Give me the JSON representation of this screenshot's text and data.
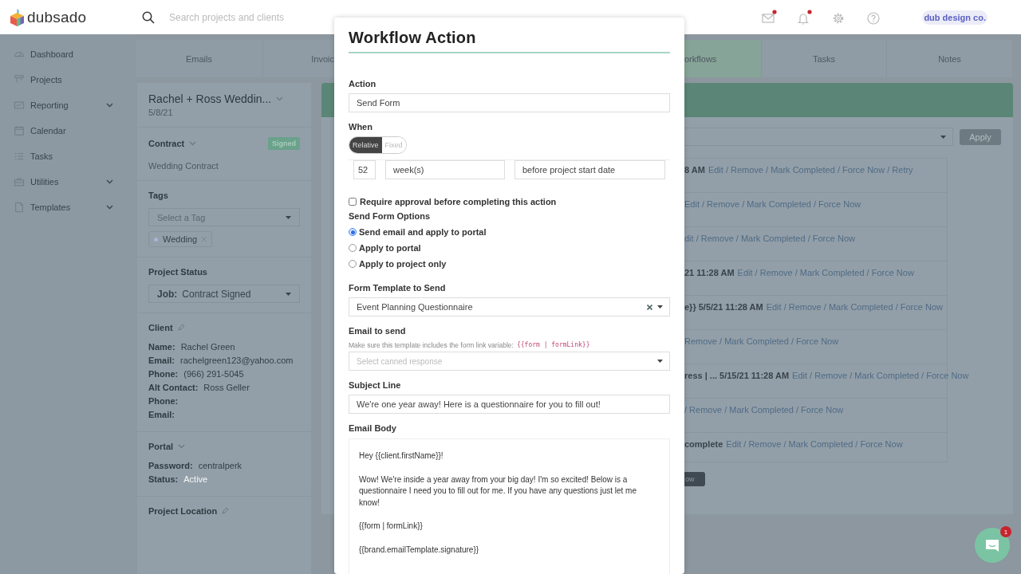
{
  "topbar": {
    "logo": "dubsado",
    "search": {
      "placeholder": "Search projects and clients"
    },
    "icons": [
      {
        "kind": "mail",
        "badge": true
      },
      {
        "kind": "bell",
        "badge": true
      },
      {
        "kind": "gear",
        "badge": false
      },
      {
        "kind": "help",
        "badge": false
      }
    ],
    "account": "dub design co."
  },
  "sidebar": {
    "items": [
      {
        "label": "Dashboard",
        "kind": "dashboard",
        "has_submenu": false
      },
      {
        "label": "Projects",
        "kind": "projects",
        "has_submenu": false
      },
      {
        "label": "Reporting",
        "kind": "reporting",
        "has_submenu": true
      },
      {
        "label": "Calendar",
        "kind": "calendar",
        "has_submenu": false
      },
      {
        "label": "Tasks",
        "kind": "tasks",
        "has_submenu": false
      },
      {
        "label": "Utilities",
        "kind": "utilities",
        "has_submenu": true
      },
      {
        "label": "Templates",
        "kind": "templates",
        "has_submenu": true
      }
    ]
  },
  "tabs": {
    "left": [
      {
        "label": "Emails",
        "selected": false
      },
      {
        "label": "Invoic",
        "selected": false
      }
    ],
    "right": [
      {
        "label": "orkflows",
        "selected": true
      },
      {
        "label": "Tasks",
        "selected": false
      },
      {
        "label": "Notes",
        "selected": false
      }
    ]
  },
  "project": {
    "title": "Rachel + Ross Weddin...",
    "date": "5/8/21",
    "contract": {
      "heading": "Contract",
      "status": "Signed",
      "name": "Wedding Contract"
    },
    "tags": {
      "heading": "Tags",
      "placeholder": "Select a Tag",
      "items": [
        {
          "label": "Wedding"
        }
      ]
    },
    "status": {
      "heading": "Project Status",
      "label": "Job:",
      "value": "Contract Signed"
    },
    "client": {
      "heading": "Client",
      "fields": [
        {
          "label": "Name:",
          "value": "Rachel Green"
        },
        {
          "label": "Email:",
          "value": "rachelgreen123@yahoo.com"
        },
        {
          "label": "Phone:",
          "value": "(966) 291-5045"
        },
        {
          "label": "Alt Contact:",
          "value": "Ross Geller"
        },
        {
          "label": "Phone:"
        },
        {
          "label": "Email:"
        }
      ]
    },
    "portal": {
      "heading": "Portal",
      "fields": [
        {
          "label": "Password:",
          "value": "centralperk",
          "muted": false
        },
        {
          "label": "Status:",
          "value": "Active",
          "muted": true
        }
      ]
    },
    "location": {
      "heading": "Project Location"
    }
  },
  "workflow": {
    "apply_button": "Apply",
    "rows": [
      {
        "prefix": "8 AM",
        "actions": "Edit / Remove / Mark Completed / Force Now / Retry"
      },
      {
        "actions": "Edit / Remove / Mark Completed / Force Now"
      },
      {
        "actions": "dit / Remove / Mark Completed / Force Now"
      },
      {
        "prefix": "21 11:28 AM",
        "actions": "Edit / Remove / Mark Completed / Force Now"
      },
      {
        "prefix": "e}} 5/5/21 11:28 AM",
        "actions": "Edit / Remove / Mark Completed / Force Now"
      },
      {
        "actions": "Remove / Mark Completed / Force Now"
      },
      {
        "prefix": "ress | ... 5/15/21 11:28 AM",
        "actions": "Edit / Remove / Mark Completed / Force Now"
      },
      {
        "actions": "/ Remove / Mark Completed / Force Now"
      },
      {
        "prefix": "complete",
        "actions": "Edit / Remove / Mark Completed / Force Now"
      }
    ],
    "bottom_button": "ow"
  },
  "modal": {
    "title": "Workflow Action",
    "action": {
      "label": "Action",
      "value": "Send Form"
    },
    "when": {
      "label": "When",
      "modes": [
        {
          "label": "Relative",
          "selected": true
        },
        {
          "label": "Fixed",
          "selected": false
        }
      ],
      "amount": "52",
      "unit": "week(s)",
      "relation": "before project start date"
    },
    "approval": {
      "label": "Require approval before completing this action",
      "checked": false
    },
    "options": {
      "label": "Send Form Options",
      "choices": [
        {
          "label": "Send email and apply to portal",
          "selected": true
        },
        {
          "label": "Apply to portal",
          "selected": false
        },
        {
          "label": "Apply to project only",
          "selected": false
        }
      ]
    },
    "template": {
      "label": "Form Template to Send",
      "value": "Event Planning Questionnaire"
    },
    "email": {
      "label": "Email to send",
      "hint": "Make sure this template includes the form link variable:",
      "code": "{{form | formLink}}",
      "placeholder": "Select canned response"
    },
    "subject": {
      "label": "Subject Line",
      "value": "We're one year away! Here is a questionnaire for you to fill out!"
    },
    "body": {
      "label": "Email Body",
      "paragraphs": [
        "Hey {{client.firstName}}!",
        "Wow! We're inside a year away from your big day! I'm so excited! Below is a questionnaire I need you to fill out for me. If you have any questions just let me know!",
        "{{form | formLink}}",
        "{{brand.emailTemplate.signature}}"
      ]
    }
  },
  "chat": {
    "badge": "1"
  }
}
